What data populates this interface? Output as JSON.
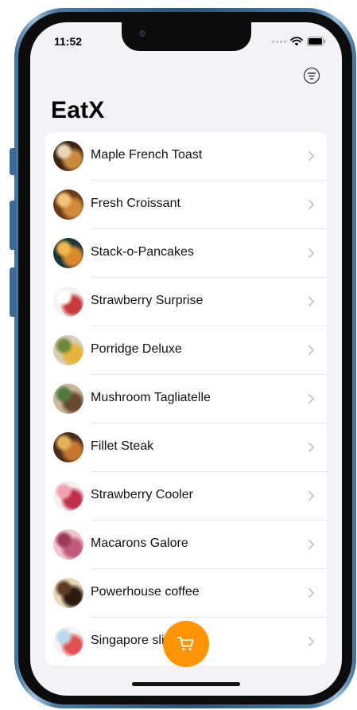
{
  "status_bar": {
    "time": "11:52"
  },
  "app": {
    "title": "EatX"
  },
  "items": [
    {
      "label": "Maple French Toast",
      "colors": [
        "#3b2412",
        "#c98a3e",
        "#e9d6b8"
      ]
    },
    {
      "label": "Fresh Croissant",
      "colors": [
        "#6b3a16",
        "#d28a3c",
        "#f0c27a"
      ]
    },
    {
      "label": "Stack-o-Pancakes",
      "colors": [
        "#16343a",
        "#d9892d",
        "#f3b64a"
      ]
    },
    {
      "label": "Strawberry Surprise",
      "colors": [
        "#f2f2f2",
        "#c93a3a",
        "#ffffff"
      ]
    },
    {
      "label": "Porridge Deluxe",
      "colors": [
        "#d8cdb8",
        "#e8b33a",
        "#6d8a3a"
      ]
    },
    {
      "label": "Mushroom Tagliatelle",
      "colors": [
        "#c9b99c",
        "#6a4a2e",
        "#4f7a3a"
      ]
    },
    {
      "label": "Fillet Steak",
      "colors": [
        "#4a2c1a",
        "#c9772e",
        "#e2b25c"
      ]
    },
    {
      "label": "Strawberry Cooler",
      "colors": [
        "#f6f0f0",
        "#c0304a",
        "#f0a0b0"
      ]
    },
    {
      "label": "Macarons Galore",
      "colors": [
        "#f3c4d0",
        "#c05a7a",
        "#9a3a5a"
      ]
    },
    {
      "label": "Powerhouse coffee",
      "colors": [
        "#e8d9b8",
        "#2a1a10",
        "#5a3a20"
      ]
    },
    {
      "label": "Singapore sli",
      "colors": [
        "#f4f4f4",
        "#e05050",
        "#bcd7ea"
      ]
    }
  ],
  "accent_color": "#ff9500",
  "icons": {
    "filter": "filter-icon",
    "cart": "cart-icon",
    "chevron": "chevron-right-icon"
  }
}
